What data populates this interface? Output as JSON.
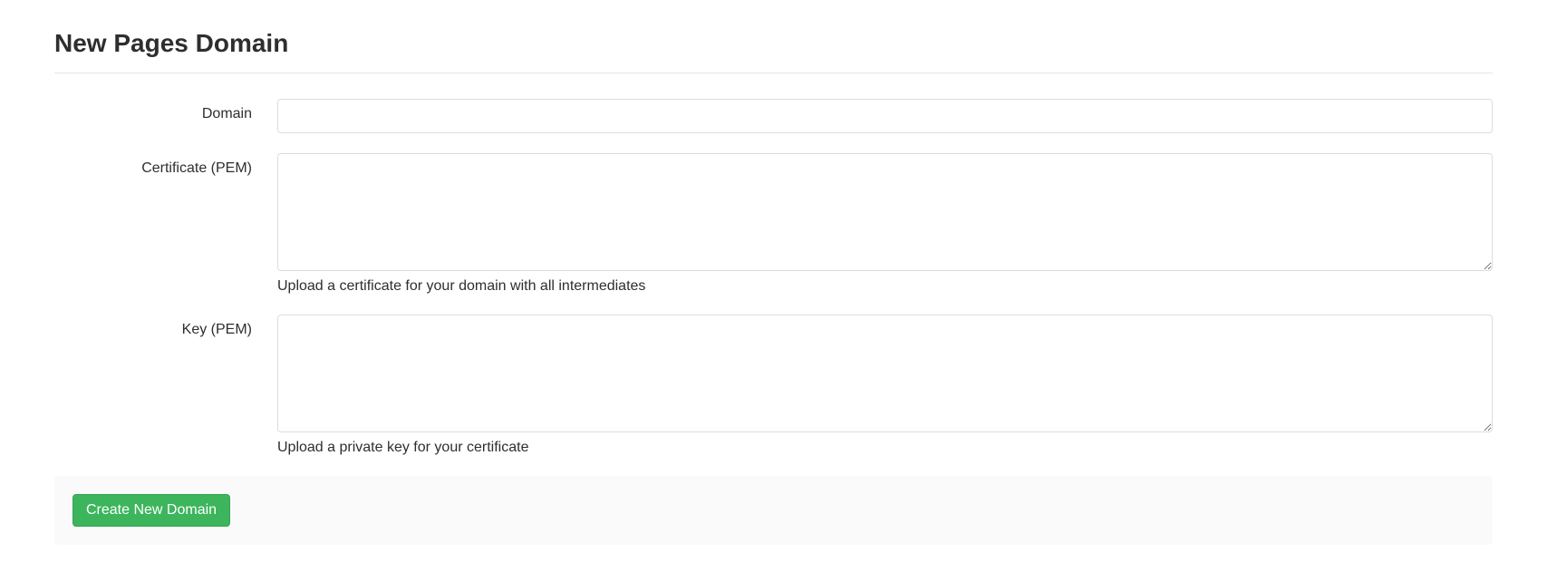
{
  "page": {
    "title": "New Pages Domain"
  },
  "form": {
    "domain": {
      "label": "Domain",
      "value": ""
    },
    "certificate": {
      "label": "Certificate (PEM)",
      "value": "",
      "help": "Upload a certificate for your domain with all intermediates"
    },
    "key": {
      "label": "Key (PEM)",
      "value": "",
      "help": "Upload a private key for your certificate"
    },
    "submit_label": "Create New Domain"
  }
}
